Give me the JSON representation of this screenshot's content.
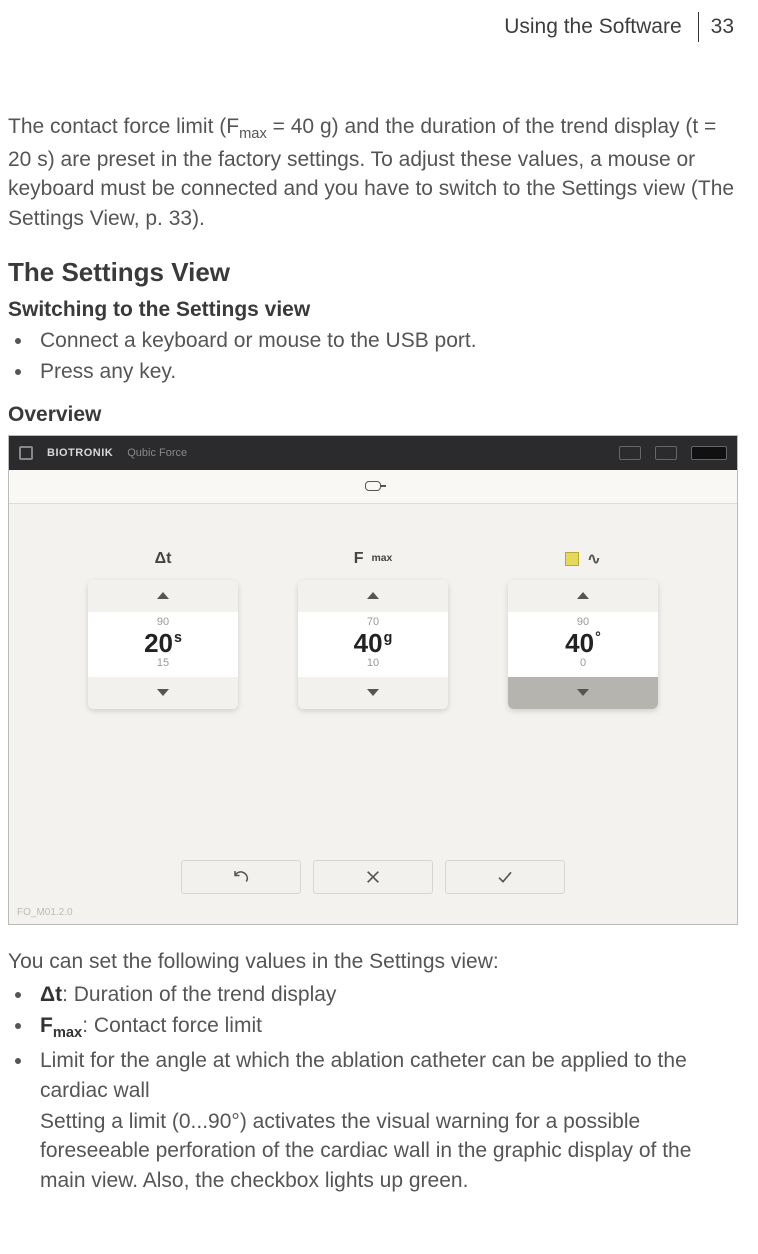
{
  "header": {
    "section": "Using the Software",
    "page": "33"
  },
  "intro": {
    "p1a": "The contact force limit (F",
    "p1_sub": "max",
    "p1b": " = 40 g) and the duration of the trend display (t = 20 s) are preset in the factory settings. To adjust these values, a mouse or keyboard must be connected and you have to switch to the Settings view (The Settings View, p. 33)."
  },
  "section_title": "The Settings View",
  "switching": {
    "heading": "Switching to the Settings view",
    "items": [
      "Connect a keyboard or mouse to the USB port.",
      "Press any key."
    ]
  },
  "overview_heading": "Overview",
  "screenshot": {
    "brand": "BIOTRONIK",
    "product": "Qubic Force",
    "corner_code": "FO_M01.2.0",
    "columns": {
      "dt": {
        "label": "Δt",
        "prev": "90",
        "value": "20",
        "unit": "s",
        "next": "15"
      },
      "fmax": {
        "label_base": "F",
        "label_sub": "max",
        "prev": "70",
        "value": "40",
        "unit": "g",
        "next": "10"
      },
      "angle": {
        "prev": "90",
        "value": "40",
        "unit": "°",
        "next": "0"
      }
    },
    "buttons": {
      "undo": "⟲",
      "cancel": "✕",
      "ok": "✓"
    }
  },
  "after": {
    "lead": "You can set the following values in the Settings view:",
    "items": [
      {
        "bold": "Δt",
        "rest": ": Duration of the trend display"
      },
      {
        "bold_base": "F",
        "bold_sub": "max",
        "rest": ": Contact force limit"
      },
      {
        "plain": "Limit for the angle at which the ablation catheter can be applied to the cardiac wall"
      }
    ],
    "continued": "Setting a limit (0...90°) activates the visual warning for a possible foreseeable perforation of the cardiac wall in the graphic display of the main view. Also, the checkbox lights up green."
  }
}
